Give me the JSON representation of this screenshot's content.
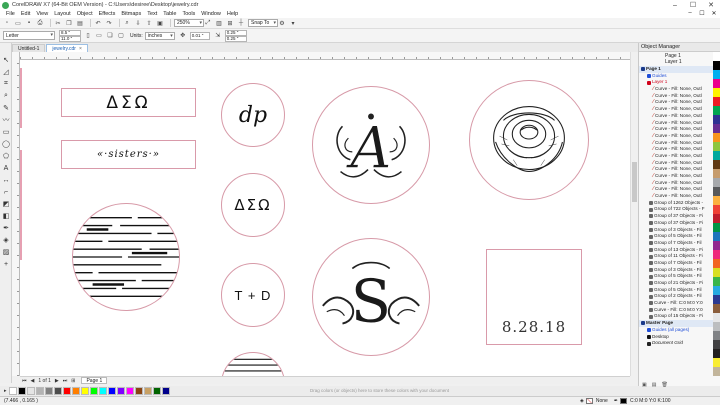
{
  "window": {
    "title": "CorelDRAW X7 (64-Bit OEM Version) - C:\\Users\\desiree\\Desktop\\jewelry.cdr",
    "controls": [
      "–",
      "☐",
      "✕"
    ]
  },
  "menu": [
    "File",
    "Edit",
    "View",
    "Layout",
    "Object",
    "Effects",
    "Bitmaps",
    "Text",
    "Table",
    "Tools",
    "Window",
    "Help"
  ],
  "toolbar": {
    "zoom": "250%",
    "snap": "Snap To"
  },
  "propbar": {
    "paper": "Letter",
    "width": "8.5 \"",
    "height": "11.0 \"",
    "units_label": "Units:",
    "units": "inches",
    "nudge": "0.01 \"",
    "dup_x": "0.25 \"",
    "dup_y": "0.25 \""
  },
  "tabs": [
    {
      "label": "Untitled-1"
    },
    {
      "label": "jewelry.cdr"
    }
  ],
  "designs": {
    "greek1": "ΔΣΩ",
    "sisters": "«·sisters·»",
    "dp": "dp",
    "greek2": "ΔΣΩ",
    "td": "T + D",
    "date": "8.28.18",
    "monogram_a": "A",
    "monogram_s": "S"
  },
  "pagenav": {
    "counter": "1 of 1",
    "page_tab": "Page 1",
    "hint": "Drag colors (or objects) here to store these colors with your document"
  },
  "status": {
    "coords": "(7.466 , 0.165 )",
    "fill_label": "None",
    "outline_label": "C:0 M:0 Y:0 K:100"
  },
  "object_manager": {
    "title": "Object Manager",
    "page": "Page 1",
    "layer": "Layer 1",
    "rows": [
      {
        "text": "Page 1",
        "kind": "page1",
        "color": "#1a3a8a"
      },
      {
        "text": "Guides",
        "kind": "layer",
        "color": "#1f4ed8"
      },
      {
        "text": "Layer 1",
        "kind": "layer",
        "color": "#d0021b"
      },
      {
        "text": "Curve - Fill: None, Outl",
        "kind": "curve",
        "color": ""
      },
      {
        "text": "Curve - Fill: None, Outl",
        "kind": "curve",
        "color": ""
      },
      {
        "text": "Curve - Fill: None, Outl",
        "kind": "curve",
        "color": ""
      },
      {
        "text": "Curve - Fill: None, Outl",
        "kind": "curve",
        "color": ""
      },
      {
        "text": "Curve - Fill: None, Outl",
        "kind": "curve",
        "color": ""
      },
      {
        "text": "Curve - Fill: None, Outl",
        "kind": "curve",
        "color": ""
      },
      {
        "text": "Curve - Fill: None, Outl",
        "kind": "curve",
        "color": ""
      },
      {
        "text": "Curve - Fill: None, Outl",
        "kind": "curve",
        "color": ""
      },
      {
        "text": "Curve - Fill: None, Outl",
        "kind": "curve",
        "color": ""
      },
      {
        "text": "Curve - Fill: None, Outl",
        "kind": "curve",
        "color": ""
      },
      {
        "text": "Curve - Fill: None, Outl",
        "kind": "curve",
        "color": ""
      },
      {
        "text": "Curve - Fill: None, Outl",
        "kind": "curve",
        "color": ""
      },
      {
        "text": "Curve - Fill: None, Outl",
        "kind": "curve",
        "color": ""
      },
      {
        "text": "Curve - Fill: None, Outl",
        "kind": "curve",
        "color": ""
      },
      {
        "text": "Curve - Fill: None, Outl",
        "kind": "curve",
        "color": ""
      },
      {
        "text": "Curve - Fill: None, Outl",
        "kind": "curve",
        "color": ""
      },
      {
        "text": "Curve - Fill: None, Outl",
        "kind": "curve",
        "color": ""
      },
      {
        "text": "Group of 1262 Objects -",
        "kind": "group",
        "color": "#666"
      },
      {
        "text": "Group of 722 Objects - F",
        "kind": "group",
        "color": "#666"
      },
      {
        "text": "Group of 37 Objects - Fi",
        "kind": "group",
        "color": "#666"
      },
      {
        "text": "Group of 37 Objects - Fi",
        "kind": "group",
        "color": "#666"
      },
      {
        "text": "Group of 3 Objects - Fil",
        "kind": "group",
        "color": "#666"
      },
      {
        "text": "Group of 5 Objects - Fil",
        "kind": "group",
        "color": "#666"
      },
      {
        "text": "Group of 7 Objects - Fil",
        "kind": "group",
        "color": "#666"
      },
      {
        "text": "Group of 13 Objects - Fi",
        "kind": "group",
        "color": "#666"
      },
      {
        "text": "Group of 11 Objects - Fi",
        "kind": "group",
        "color": "#666"
      },
      {
        "text": "Group of 7 Objects - Fil",
        "kind": "group",
        "color": "#666"
      },
      {
        "text": "Group of 3 Objects - Fil",
        "kind": "group",
        "color": "#666"
      },
      {
        "text": "Group of 5 Objects - Fil",
        "kind": "group",
        "color": "#666"
      },
      {
        "text": "Group of 21 Objects - Fi",
        "kind": "group",
        "color": "#666"
      },
      {
        "text": "Group of 5 Objects - Fil",
        "kind": "group",
        "color": "#666"
      },
      {
        "text": "Group of 2 Objects - Fil",
        "kind": "group",
        "color": "#666"
      },
      {
        "text": "Curve - Fill: C:0 M:0 Y:0",
        "kind": "group",
        "color": "#666"
      },
      {
        "text": "Curve - Fill: C:0 M:0 Y:0",
        "kind": "group",
        "color": "#666"
      },
      {
        "text": "Group of 15 Objects - Fi",
        "kind": "group",
        "color": "#666"
      },
      {
        "text": "Master Page",
        "kind": "master",
        "color": "#1a3a8a"
      },
      {
        "text": "Guides (all pages)",
        "kind": "mlayer",
        "color": "#1f4ed8"
      },
      {
        "text": "Desktop",
        "kind": "mlayer",
        "color": "#111"
      },
      {
        "text": "Document Grid",
        "kind": "mlayer",
        "color": "#222"
      }
    ]
  },
  "colors": {
    "accent": "#1a5fb4",
    "page_outline": "#e6a0b2",
    "frame": "#d99aaa"
  },
  "palette": [
    "#ffffff",
    "#000000",
    "#e5e5e5",
    "#b3b3b3",
    "#808080",
    "#4d4d4d",
    "#ff0000",
    "#ff7f00",
    "#ffff00",
    "#00ff00",
    "#00ffff",
    "#0000ff",
    "#7f00ff",
    "#ff00ff",
    "#8b4513",
    "#c8a165",
    "#006400",
    "#00008b"
  ],
  "right_palette": [
    "#ffffff",
    "#000000",
    "#00aeef",
    "#ec008c",
    "#fff200",
    "#ed1c24",
    "#00a651",
    "#2e3192",
    "#662d91",
    "#f7941d",
    "#8dc63f",
    "#00a99d",
    "#603913",
    "#c69c6d",
    "#a7a9ac",
    "#58595b",
    "#fbb040",
    "#ef4136",
    "#be1e2d",
    "#009444",
    "#1c75bc",
    "#92278f",
    "#ee2a7b",
    "#f26522",
    "#d7df23",
    "#39b54a",
    "#27aae1",
    "#2b3990",
    "#8b5e3c",
    "#e6e7e8",
    "#bcbec0",
    "#808285",
    "#414042",
    "#231f20",
    "#f9ed32",
    "#c2b59b"
  ]
}
